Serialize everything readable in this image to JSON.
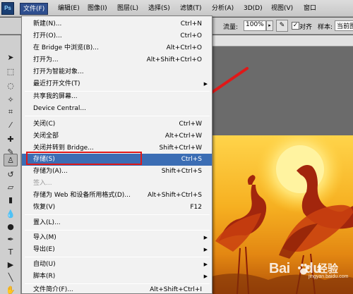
{
  "app": {
    "logo": "Ps"
  },
  "menubar": {
    "items": [
      "文件(F)",
      "编辑(E)",
      "图像(I)",
      "图层(L)",
      "选择(S)",
      "滤镜(T)",
      "分析(A)",
      "3D(D)",
      "视图(V)",
      "窗口"
    ],
    "active_index": 0
  },
  "options": {
    "flow_label": "流量:",
    "flow_value": "100%",
    "align_label": "对齐",
    "sample_label": "样本:",
    "sample_value": "当前图层"
  },
  "file_menu": {
    "items": [
      {
        "label": "新建(N)...",
        "shortcut": "Ctrl+N"
      },
      {
        "label": "打开(O)...",
        "shortcut": "Ctrl+O"
      },
      {
        "label": "在 Bridge 中浏览(B)...",
        "shortcut": "Alt+Ctrl+O"
      },
      {
        "label": "打开为...",
        "shortcut": "Alt+Shift+Ctrl+O"
      },
      {
        "label": "打开为智能对象..."
      },
      {
        "label": "最近打开文件(T)",
        "submenu": true
      },
      {
        "label": "共享我的屏幕..."
      },
      {
        "label": "Device Central..."
      },
      {
        "label": "关闭(C)",
        "shortcut": "Ctrl+W"
      },
      {
        "label": "关闭全部",
        "shortcut": "Alt+Ctrl+W"
      },
      {
        "label": "关闭并转到 Bridge...",
        "shortcut": "Shift+Ctrl+W"
      },
      {
        "label": "存储(S)",
        "shortcut": "Ctrl+S",
        "highlighted": true
      },
      {
        "label": "存储为(A)...",
        "shortcut": "Shift+Ctrl+S"
      },
      {
        "label": "签入...",
        "disabled": true
      },
      {
        "label": "存储为 Web 和设备所用格式(D)...",
        "shortcut": "Alt+Shift+Ctrl+S"
      },
      {
        "label": "恢复(V)",
        "shortcut": "F12"
      },
      {
        "label": "置入(L)..."
      },
      {
        "label": "导入(M)",
        "submenu": true
      },
      {
        "label": "导出(E)",
        "submenu": true
      },
      {
        "label": "自动(U)",
        "submenu": true
      },
      {
        "label": "脚本(R)",
        "submenu": true
      },
      {
        "label": "文件简介(F)...",
        "shortcut": "Alt+Shift+Ctrl+I"
      }
    ]
  },
  "watermark": {
    "brand": "Bai",
    "brand_suffix": "du",
    "product": "经验",
    "url": "jingyan.baidu.com"
  },
  "colors": {
    "highlight": "#3b6db4",
    "annotation_red": "#e01818",
    "menu_active": "#2f4f8f"
  }
}
